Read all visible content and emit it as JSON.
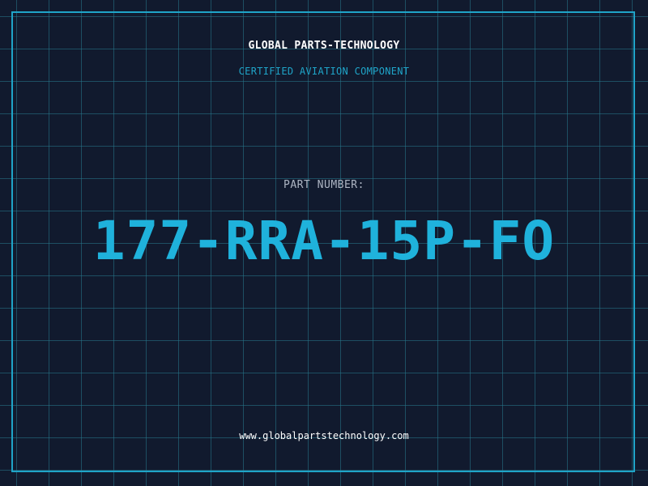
{
  "header": {
    "company_name": "GLOBAL PARTS-TECHNOLOGY",
    "tagline": "CERTIFIED AVIATION COMPONENT"
  },
  "part": {
    "label": "PART NUMBER:",
    "number": "177-RRA-15P-FO"
  },
  "footer": {
    "website": "www.globalpartstechnology.com"
  },
  "colors": {
    "background": "#111a2e",
    "grid": "#26788c",
    "accent": "#1fa4c8",
    "part_number": "#1fb2dc",
    "label": "#aeb6c4",
    "text": "#ffffff"
  }
}
